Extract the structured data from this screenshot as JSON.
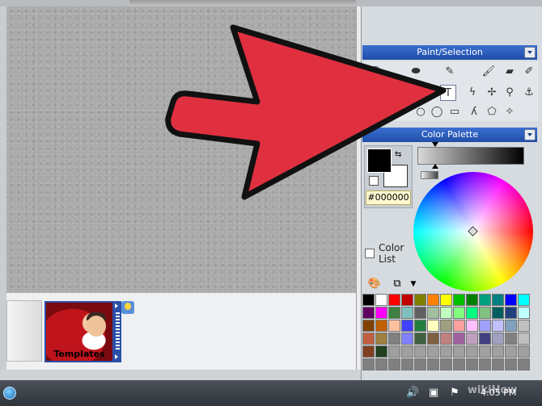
{
  "panels": {
    "paint_selection": {
      "title": "Paint/Selection"
    },
    "color_palette": {
      "title": "Color Palette",
      "hex_value": "#000000",
      "color_list_label": "Color List"
    }
  },
  "tray": {
    "template_label": "Templates"
  },
  "taskbar": {
    "clock": "4:05 PM"
  },
  "watermark": "wikiHow",
  "colors": {
    "arrow_fill": "#e03040",
    "panel_title_bg": "#1f4ea8",
    "canvas_bg": "#a9a9a9"
  },
  "swatches": [
    "#000000",
    "#ffffff",
    "#ff0000",
    "#c00000",
    "#808000",
    "#ff8000",
    "#ffff00",
    "#00c000",
    "#008000",
    "#00a080",
    "#008080",
    "#0000ff",
    "#00ffff",
    "#600060",
    "#ff00ff",
    "#408040",
    "#80c0c0",
    "#606060",
    "#a0c0a0",
    "#c0ffc0",
    "#80ff80",
    "#00ff80",
    "#80c080",
    "#006060",
    "#204080",
    "#c0ffff",
    "#804000",
    "#c06000",
    "#ffc0a0",
    "#4040ff",
    "#208040",
    "#ffffc0",
    "#a0a080",
    "#ffa0a0",
    "#ffc0ff",
    "#a0a0ff",
    "#c0c0ff",
    "#80a0c0",
    "#c0c0c0",
    "#c06040",
    "#a08040",
    "#808080",
    "#8080ff",
    "#406040",
    "#806040",
    "#c08080",
    "#a060a0",
    "#c0a0c0",
    "#404080",
    "#a0a0c0",
    "#808080",
    "#c0c0c0",
    "#804020",
    "#204020",
    "#a0a0a0",
    "#a0a0a0",
    "#a0a0a0",
    "#a0a0a0",
    "#a0a0a0",
    "#a0a0a0",
    "#a0a0a0",
    "#a0a0a0",
    "#a0a0a0",
    "#a0a0a0",
    "#a0a0a0",
    "#808080",
    "#808080",
    "#808080",
    "#808080",
    "#808080",
    "#808080",
    "#808080",
    "#808080",
    "#808080",
    "#808080",
    "#808080",
    "#808080",
    "#808080"
  ]
}
